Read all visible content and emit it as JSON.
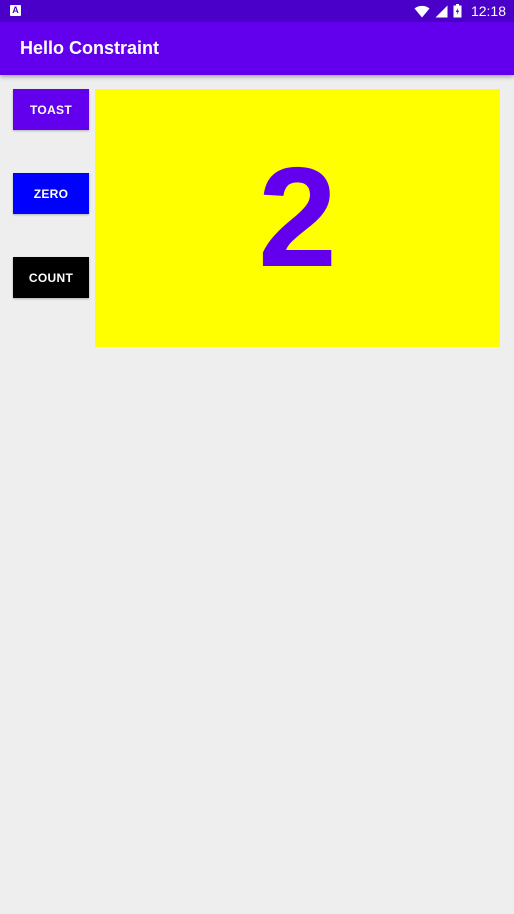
{
  "status_bar": {
    "notification_icon": "A",
    "time": "12:18",
    "icons": [
      "wifi-icon",
      "signal-icon",
      "battery-icon"
    ]
  },
  "app_bar": {
    "title": "Hello Constraint"
  },
  "buttons": {
    "toast_label": "TOAST",
    "zero_label": "ZERO",
    "count_label": "COUNT"
  },
  "counter": {
    "value": "2"
  },
  "colors": {
    "status_bar": "#4a00c8",
    "app_bar": "#6200ee",
    "toast_button": "#6200ee",
    "zero_button": "#0000ff",
    "count_button": "#000000",
    "count_box": "#ffff00",
    "count_text": "#6200ee",
    "background": "#eeeeee"
  }
}
